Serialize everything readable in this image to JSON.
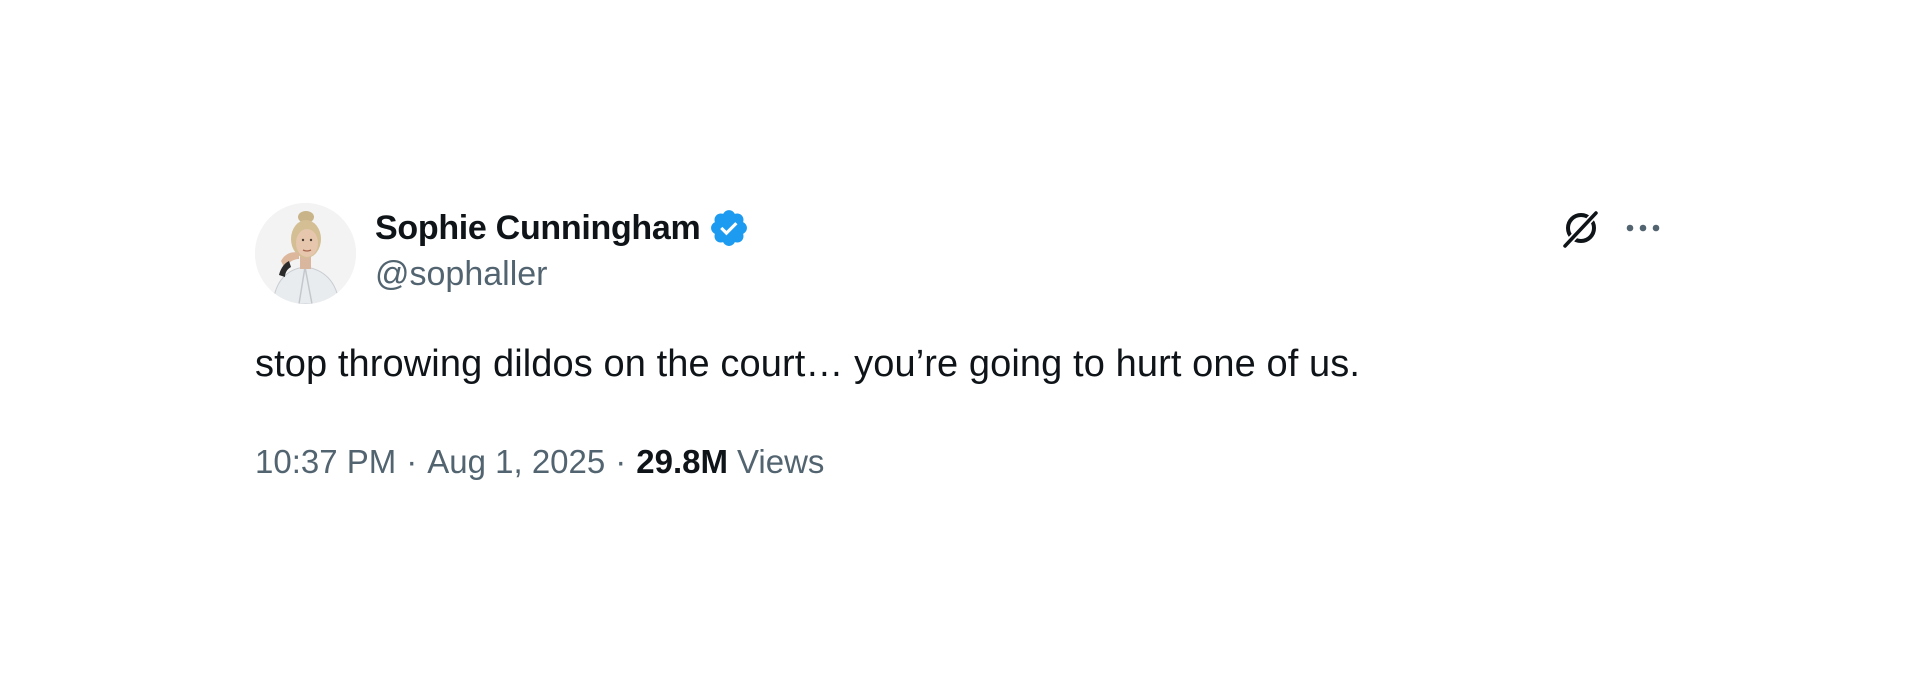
{
  "author": {
    "display_name": "Sophie Cunningham",
    "handle": "@sophaller",
    "verified": true,
    "verified_color": "#1d9bf0"
  },
  "tweet": {
    "text": "stop throwing dildos on the court… you’re going to hurt one of us."
  },
  "meta": {
    "time": "10:37 PM",
    "date": "Aug 1, 2025",
    "separator": "·",
    "views_count": "29.8M",
    "views_label": "Views"
  },
  "icons": {
    "grok": "grok-icon",
    "more": "more-dots-icon",
    "verified": "verified-badge-icon"
  }
}
